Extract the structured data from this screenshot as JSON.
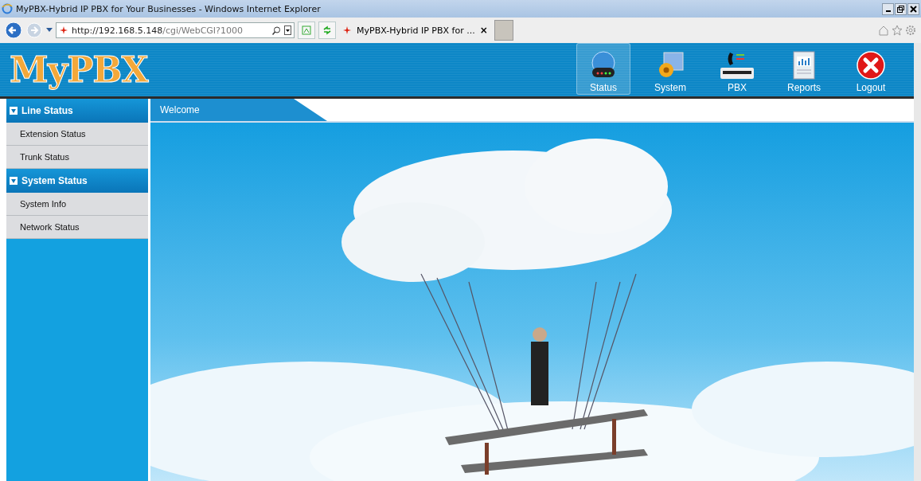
{
  "window": {
    "title": "MyPBX-Hybrid IP PBX for Your Businesses - Windows Internet Explorer"
  },
  "browser": {
    "address": {
      "host": "http://192.168.5.148",
      "path": "/cgi/WebCGI?1000"
    },
    "tab": {
      "label": "MyPBX-Hybrid IP PBX for ...",
      "close": "×"
    }
  },
  "header": {
    "logo": "MyPBX",
    "nav": [
      {
        "label": "Status",
        "kind": "status",
        "selected": true
      },
      {
        "label": "System",
        "kind": "system",
        "selected": false
      },
      {
        "label": "PBX",
        "kind": "pbx",
        "selected": false
      },
      {
        "label": "Reports",
        "kind": "reports",
        "selected": false
      },
      {
        "label": "Logout",
        "kind": "logout",
        "selected": false
      }
    ]
  },
  "sidebar": {
    "groups": [
      {
        "title": "Line Status",
        "expanded": true,
        "items": [
          "Extension Status",
          "Trunk Status"
        ]
      },
      {
        "title": "System Status",
        "expanded": true,
        "items": [
          "System Info",
          "Network Status"
        ]
      }
    ]
  },
  "content": {
    "tab": "Welcome"
  }
}
